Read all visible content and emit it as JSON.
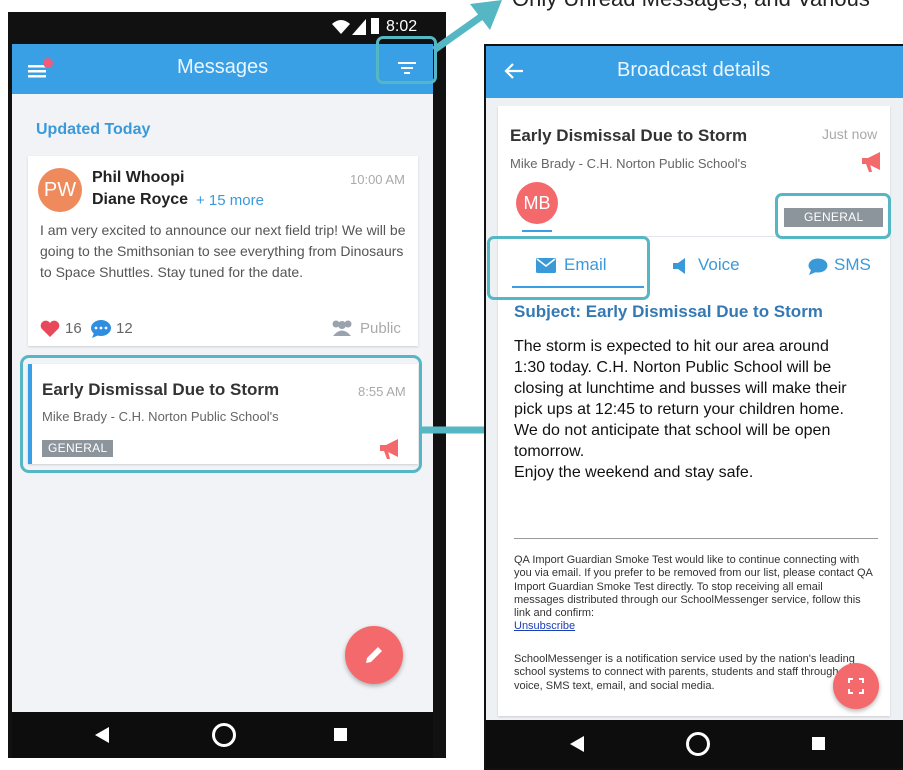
{
  "top_caption": "Only Unread Messages, and Various",
  "left": {
    "status_time": "8:02",
    "title": "Messages",
    "section_label": "Updated Today",
    "card1": {
      "avatar": "PW",
      "name": "Phil Whoopi",
      "time": "10:00 AM",
      "name2": "Diane Royce",
      "more": "+ 15 more",
      "body": "I am very excited to announce our next field trip! We will be going to the Smithsonian to see everything from Dinosaurs to Space Shuttles. Stay tuned for the date.",
      "likes": "16",
      "comments": "12",
      "audience": "Public"
    },
    "card2": {
      "title": "Early Dismissal Due to Storm",
      "time": "8:55 AM",
      "sender": "Mike Brady - C.H. Norton Public School's",
      "badge": "GENERAL"
    }
  },
  "right": {
    "title": "Broadcast details",
    "msg_title": "Early Dismissal Due to Storm",
    "time": "Just now",
    "sender": "Mike Brady - C.H. Norton Public School's",
    "avatar": "MB",
    "badge": "GENERAL",
    "tabs": [
      "Email",
      "Voice",
      "SMS"
    ],
    "subject": "Subject: Early Dismissal Due to Storm",
    "body_lines": [
      "The storm is expected to hit our area around",
      "1:30 today. C.H. Norton Public School will be",
      "closing at lunchtime and busses will make their",
      "pick ups at 12:45 to return your children home.",
      "We do not anticipate that school will be open",
      "tomorrow.",
      "Enjoy the weekend and stay safe."
    ],
    "footer1": "QA Import Guardian Smoke Test would like to continue connecting with you via email. If you prefer to be removed from our list, please contact QA Import Guardian Smoke Test directly. To stop receiving all email messages distributed through our SchoolMessenger service, follow this link and confirm:",
    "unsubscribe": "Unsubscribe",
    "footer2": "SchoolMessenger is a notification service used by the nation's leading school systems to connect with parents, students and staff through voice, SMS text, email, and social media."
  },
  "colors": {
    "primary": "#3aa0e6",
    "accent": "#f46a6c",
    "highlight": "#54b7c3",
    "heart": "#e8485a",
    "bubble": "#2f8ee0"
  }
}
